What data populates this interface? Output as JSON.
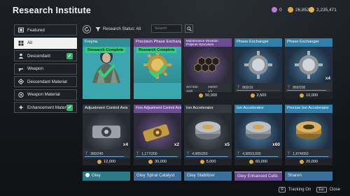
{
  "header": {
    "title": "Research Institute",
    "currencies": [
      {
        "icon": "purple-token-icon",
        "value": "0",
        "color": "#b77bd9"
      },
      {
        "icon": "gold-coin-icon",
        "value": "26,852",
        "color": "#d7a847"
      },
      {
        "icon": "kuiper-coin-icon",
        "value": "2,235,471",
        "color": "#e0b54a"
      }
    ]
  },
  "sidebar": {
    "items": [
      {
        "label": "Featured",
        "icon": "featured-icon",
        "active": false,
        "checked": false
      },
      {
        "label": "All",
        "icon": "grid-icon",
        "active": true,
        "checked": false
      },
      {
        "label": "Descendant",
        "icon": "descendant-icon",
        "active": false,
        "checked": true
      },
      {
        "label": "Weapon",
        "icon": "weapon-icon",
        "active": false,
        "checked": false
      },
      {
        "label": "Descendant Material",
        "icon": "material-icon",
        "active": false,
        "checked": false
      },
      {
        "label": "Weapon Material",
        "icon": "weapon-material-icon",
        "active": false,
        "checked": false
      },
      {
        "label": "Enhancement Materi...",
        "icon": "enhancement-icon",
        "active": false,
        "checked": true
      }
    ]
  },
  "filter": {
    "status_label": "Research Status: All",
    "search_placeholder": "Search"
  },
  "cards": [
    {
      "title": "Freyna",
      "theme": "teal",
      "complete": true,
      "complete_label": "Research Complete",
      "art": "freyna-portrait",
      "progress": "",
      "cost": ""
    },
    {
      "title": "Precision Phase Exchanger",
      "theme": "purple",
      "complete": true,
      "complete_label": "Research Complete",
      "art": "phase-exchanger-gold",
      "progress": "",
      "cost": ""
    },
    {
      "title": "Maintenance Devotion Polymer Syncytium",
      "theme": "purple",
      "complete": false,
      "art": "honeycomb-polymer",
      "stats": [
        "457/300",
        "298/87",
        "42/8",
        "1/1"
      ],
      "cost": "50,000"
    },
    {
      "title": "Phase Exchanger",
      "theme": "blue",
      "complete": false,
      "art": "phase-exchanger-silver",
      "progress": "869/16",
      "progress_fraction": 0.55,
      "cost": "2,500"
    },
    {
      "title": "Phase Exchanger",
      "theme": "blue",
      "complete": false,
      "art": "phase-exchanger-silver",
      "progress": "869/200",
      "progress_fraction": 0.9,
      "cost": "10,000",
      "badge": "x4"
    },
    {
      "title": "Adjustment Control Axis",
      "theme": "dark",
      "complete": false,
      "art": "control-axis-silver",
      "progress": "380/240",
      "progress_fraction": 0.9,
      "cost": "12,000",
      "badge": "x4"
    },
    {
      "title": "Fine Adjustment Control Axis",
      "theme": "purple",
      "complete": false,
      "art": "control-axis-gold",
      "progress": "1,177/200",
      "progress_fraction": 0.95,
      "cost": "30,000",
      "badge": "x2"
    },
    {
      "title": "Ion Accelerator",
      "theme": "dark",
      "complete": false,
      "art": "ion-accelerator",
      "progress": "4,985/250",
      "progress_fraction": 0.95,
      "cost": "5,000",
      "badge": "x5"
    },
    {
      "title": "Ion Accelerator",
      "theme": "blue",
      "complete": false,
      "art": "ion-accelerator",
      "progress": "4,985/3,000",
      "progress_fraction": 0.95,
      "cost": "60,000",
      "badge": "x60"
    },
    {
      "title": "Precise Ion Accelerator",
      "theme": "blue",
      "complete": false,
      "art": "ion-accelerator-gold",
      "progress": "1,974/650",
      "progress_fraction": 0.95,
      "cost": "20,000"
    }
  ],
  "bottom_tabs": [
    {
      "label": "Gley",
      "icon": "gley-icon"
    },
    {
      "label": "Gley Spiral Catalyst"
    },
    {
      "label": "Gley Stabilizer"
    },
    {
      "label": "Gley Enhanced Cells"
    },
    {
      "label": "Sharen"
    }
  ],
  "footer": {
    "tracking_key": "R",
    "tracking_label": "Tracking On",
    "close_key": "Esc",
    "close_label": "Close"
  }
}
